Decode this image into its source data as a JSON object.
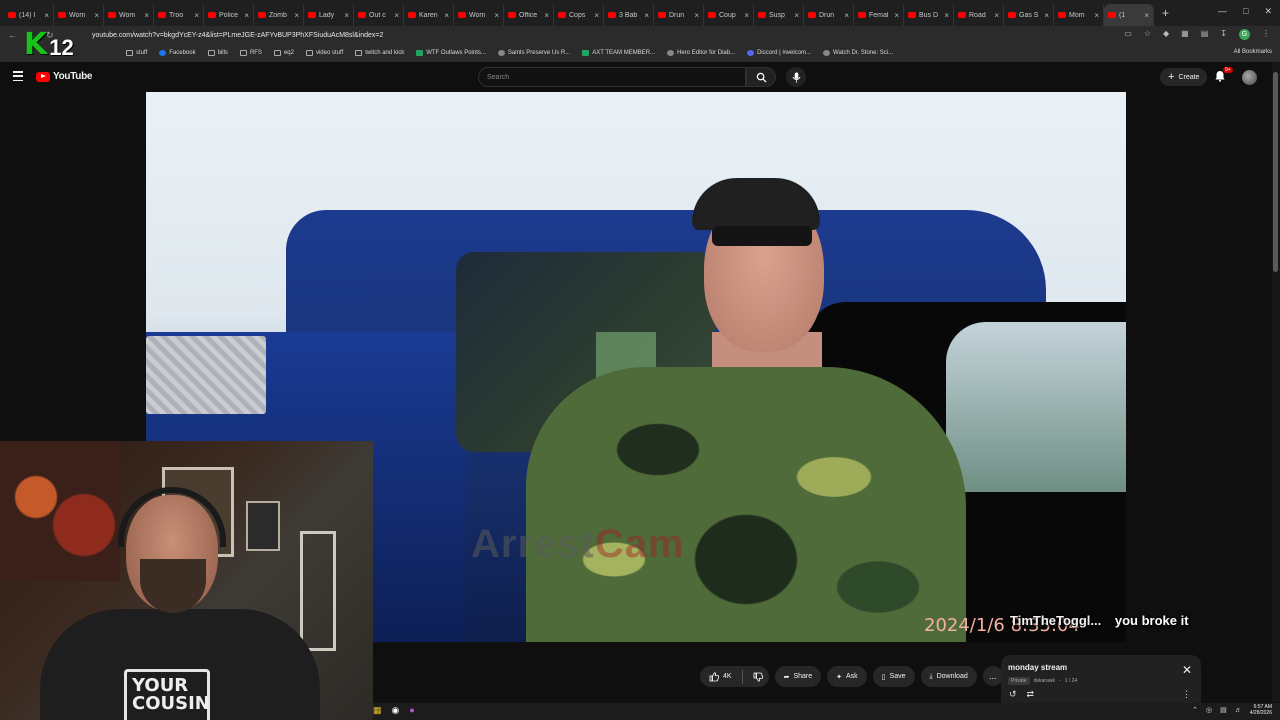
{
  "browser": {
    "tabs": [
      {
        "label": "(14) I",
        "active": false
      },
      {
        "label": "Wom",
        "active": false
      },
      {
        "label": "Wom",
        "active": false
      },
      {
        "label": "Troo",
        "active": false
      },
      {
        "label": "Police",
        "active": false
      },
      {
        "label": "Zomb",
        "active": false
      },
      {
        "label": "Lady",
        "active": false
      },
      {
        "label": "Out c",
        "active": false
      },
      {
        "label": "Karen",
        "active": false
      },
      {
        "label": "Wom",
        "active": false
      },
      {
        "label": "Office",
        "active": false
      },
      {
        "label": "Cops",
        "active": false
      },
      {
        "label": "3 Bab",
        "active": false
      },
      {
        "label": "Drun",
        "active": false
      },
      {
        "label": "Coup",
        "active": false
      },
      {
        "label": "Susp",
        "active": false
      },
      {
        "label": "Drun",
        "active": false
      },
      {
        "label": "Femal",
        "active": false
      },
      {
        "label": "Bus D",
        "active": false
      },
      {
        "label": "Road",
        "active": false
      },
      {
        "label": "Gas S",
        "active": false
      },
      {
        "label": "Mom",
        "active": false
      },
      {
        "label": "(1",
        "active": true
      }
    ],
    "new_tab": "+",
    "url": "youtube.com/watch?v=bkgdYcEY-z4&list=PLmeJGE-zAFYvBUP3PhXFSiuduAcM8sl&index=2",
    "profile_initial": "G",
    "bookmarks": [
      {
        "label": "stuff",
        "icon": "folder"
      },
      {
        "label": "Facebook",
        "icon": "facebook"
      },
      {
        "label": "bills",
        "icon": "folder"
      },
      {
        "label": "RFS",
        "icon": "folder"
      },
      {
        "label": "eq2",
        "icon": "folder"
      },
      {
        "label": "video stuff",
        "icon": "folder"
      },
      {
        "label": "twitch and kick",
        "icon": "folder"
      },
      {
        "label": "WTF Outlaws Points...",
        "icon": "sheet"
      },
      {
        "label": "Saints Preserve Us R...",
        "icon": "page"
      },
      {
        "label": "AXT TEAM MEMBER...",
        "icon": "sheet"
      },
      {
        "label": "Hero Editor for Diab...",
        "icon": "page"
      },
      {
        "label": "Discord | #welcom...",
        "icon": "discord"
      },
      {
        "label": "Watch Dr. Stone: Sci...",
        "icon": "page"
      }
    ],
    "all_bookmarks": "All Bookmarks"
  },
  "overlay": {
    "k_logo": "K",
    "k_number": "12"
  },
  "youtube": {
    "logo_text": "YouTube",
    "search_placeholder": "Search",
    "create_label": "Create",
    "notification_badge": "9+"
  },
  "video": {
    "watermark_1": "Arrest",
    "watermark_2": "Cam",
    "timestamp": "2024/1/6   8:35:04"
  },
  "chat": {
    "user": "TimTheToggl...",
    "message": "you broke it"
  },
  "actions": {
    "likes": "4K",
    "share": "Share",
    "ask": "Ask",
    "save": "Save",
    "download": "Download",
    "more": "..."
  },
  "playlist": {
    "title": "monday stream",
    "privacy": "Private",
    "owner": "dekarawk",
    "position": "1 / 24"
  },
  "webcam": {
    "shirt_text_1": "YOUR",
    "shirt_text_2": "COUSIN"
  },
  "taskbar": {
    "time": "6:57 AM",
    "date": "4/28/2026"
  },
  "colors": {
    "youtube_red": "#ff0000",
    "k12_green": "#17c21a",
    "page_bg": "#0f0f0f"
  }
}
